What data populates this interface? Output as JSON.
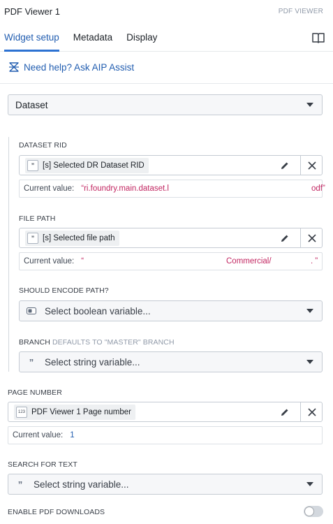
{
  "header": {
    "title": "PDF Viewer 1",
    "type_label": "PDF VIEWER"
  },
  "tabs": [
    {
      "label": "Widget setup",
      "active": true
    },
    {
      "label": "Metadata",
      "active": false
    },
    {
      "label": "Display",
      "active": false
    }
  ],
  "help": {
    "label": "Need help? Ask AIP Assist"
  },
  "source_select": {
    "value": "Dataset"
  },
  "dataset_rid": {
    "label": "DATASET RID",
    "variable": "[s] Selected DR Dataset RID",
    "current_label": "Current value:",
    "current_value_start": "“ri.foundry.main.dataset.l",
    "current_value_end": "odf”"
  },
  "file_path": {
    "label": "FILE PATH",
    "variable": "[s] Selected file path",
    "current_label": "Current value:",
    "current_value_start": "“",
    "current_value_mid": "Commercial/",
    "current_value_end": ". ”"
  },
  "encode_path": {
    "label": "SHOULD ENCODE PATH?",
    "placeholder": "Select boolean variable..."
  },
  "branch": {
    "label": "BRANCH",
    "sublabel": "DEFAULTS TO \"MASTER\" BRANCH",
    "placeholder": "Select string variable..."
  },
  "page_number": {
    "label": "PAGE NUMBER",
    "variable": "PDF Viewer 1 Page number",
    "type_icon": "123",
    "current_label": "Current value:",
    "current_value": "1"
  },
  "search_text": {
    "label": "SEARCH FOR TEXT",
    "placeholder": "Select string variable..."
  },
  "downloads": {
    "label": "ENABLE PDF DOWNLOADS",
    "enabled": false
  },
  "icons": {
    "string_type": "”",
    "book": "book-icon",
    "help": "ai-assist-icon",
    "pencil": "pencil-icon",
    "close": "close-icon",
    "boolean": "toggle-icon"
  },
  "colors": {
    "accent": "#2d72d2",
    "link": "#215db0",
    "value_string": "#c22762"
  }
}
